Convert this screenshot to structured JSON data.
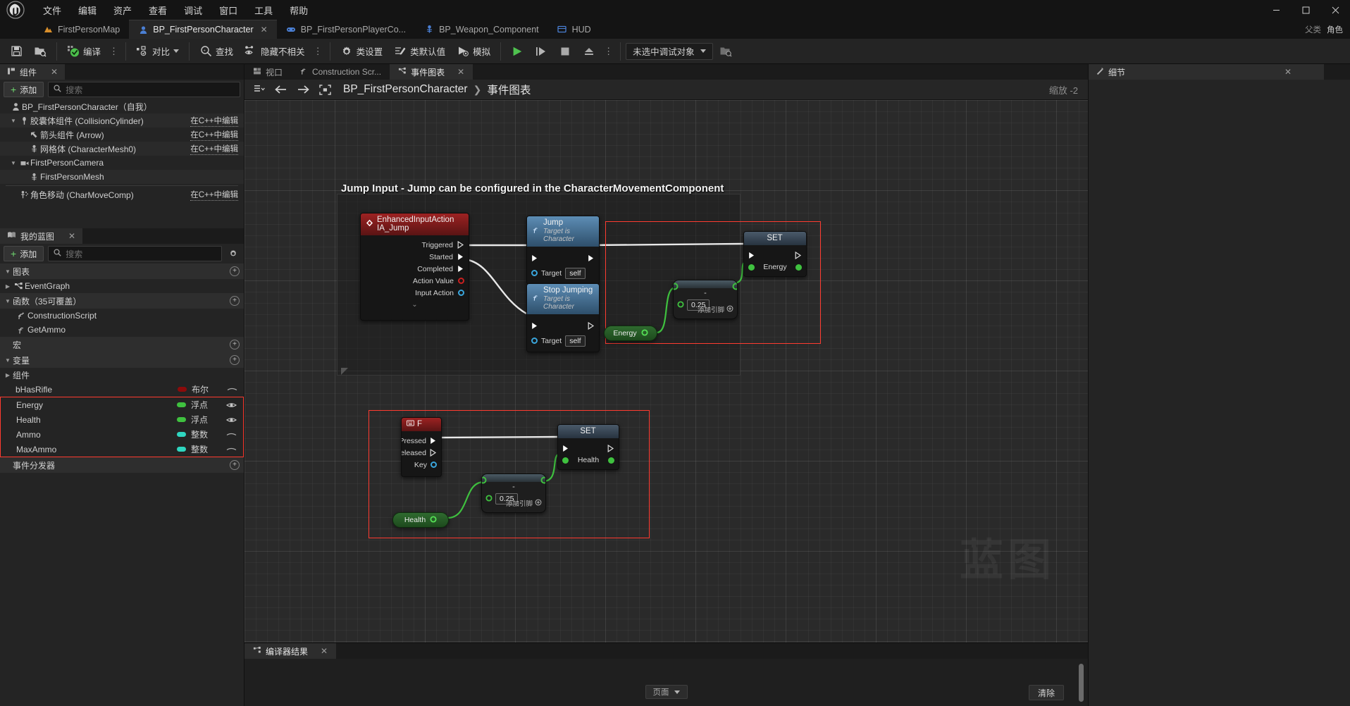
{
  "app": {
    "logo": "unreal-engine-logo",
    "menu": [
      "文件",
      "编辑",
      "资产",
      "查看",
      "调试",
      "窗口",
      "工具",
      "帮助"
    ],
    "window_controls": {
      "minimize": "–",
      "maximize": "▢",
      "close": "✕"
    }
  },
  "tabs": [
    {
      "label": "FirstPersonMap",
      "icon": "map-icon",
      "active": false,
      "closable": false
    },
    {
      "label": "BP_FirstPersonCharacter",
      "icon": "character-icon",
      "active": true,
      "closable": true
    },
    {
      "label": "BP_FirstPersonPlayerCo...",
      "icon": "gamepad-icon",
      "active": false,
      "closable": false
    },
    {
      "label": "BP_Weapon_Component",
      "icon": "skeleton-icon",
      "active": false,
      "closable": false
    },
    {
      "label": "HUD",
      "icon": "hud-icon",
      "active": false,
      "closable": false
    }
  ],
  "tab_meta": {
    "parent_label": "父类",
    "parent_value": "角色"
  },
  "toolbar": {
    "save": "保存",
    "browse": "浏览",
    "compile": "编译",
    "diff": "对比",
    "find": "查找",
    "hide_unrelated": "隐藏不相关",
    "class_settings": "类设置",
    "class_defaults": "类默认值",
    "simulate": "模拟",
    "play": "播放",
    "step": "单步",
    "stop": "停止",
    "eject": "弹出",
    "debug_object": "未选中调试对象"
  },
  "components_panel": {
    "title": "组件",
    "add_label": "添加",
    "search_placeholder": "搜索",
    "cpp_link": "在C++中编辑",
    "items": [
      {
        "label": "BP_FirstPersonCharacter（自我）",
        "icon": "character-icon",
        "depth": 0,
        "expander": "",
        "cpp": false
      },
      {
        "label": "胶囊体组件 (CollisionCylinder)",
        "icon": "capsule-icon",
        "depth": 1,
        "expander": "down",
        "cpp": true
      },
      {
        "label": "箭头组件 (Arrow)",
        "icon": "arrow-icon",
        "depth": 2,
        "expander": "",
        "cpp": true
      },
      {
        "label": "网格体 (CharacterMesh0)",
        "icon": "mesh-icon",
        "depth": 2,
        "expander": "",
        "cpp": true
      },
      {
        "label": "FirstPersonCamera",
        "icon": "camera-icon",
        "depth": 1,
        "expander": "down",
        "cpp": false
      },
      {
        "label": "FirstPersonMesh",
        "icon": "mesh-icon",
        "depth": 2,
        "expander": "",
        "cpp": false
      },
      {
        "label": "角色移动 (CharMoveComp)",
        "icon": "movement-icon",
        "depth": 1,
        "expander": "",
        "cpp": true
      }
    ]
  },
  "myblueprint_panel": {
    "title": "我的蓝图",
    "add_label": "添加",
    "search_placeholder": "搜索",
    "sections": [
      {
        "name": "图表",
        "expander": "down",
        "rows": [
          {
            "label": "EventGraph",
            "icon": "graph-icon",
            "expander": "right"
          }
        ]
      },
      {
        "name": "函数（35可覆盖）",
        "expander": "down",
        "rows": [
          {
            "label": "ConstructionScript",
            "icon": "function-construct-icon",
            "expander": ""
          },
          {
            "label": "GetAmmo",
            "icon": "function-icon",
            "expander": ""
          }
        ]
      },
      {
        "name": "宏",
        "expander": "",
        "rows": []
      },
      {
        "name": "变量",
        "expander": "down",
        "rows": []
      }
    ],
    "components_group": {
      "label": "组件",
      "expander": "right"
    },
    "variables": [
      {
        "name": "bHasRifle",
        "type": "布尔",
        "color": "#8c0b0b",
        "eye": "hidden-eye",
        "highlighted": false
      },
      {
        "name": "Energy",
        "type": "浮点",
        "color": "#3fc13f",
        "eye": "visible-eye",
        "highlighted": true
      },
      {
        "name": "Health",
        "type": "浮点",
        "color": "#3fc13f",
        "eye": "visible-eye",
        "highlighted": true
      },
      {
        "name": "Ammo",
        "type": "整数",
        "color": "#2fd6c0",
        "eye": "hidden-eye",
        "highlighted": true
      },
      {
        "name": "MaxAmmo",
        "type": "整数",
        "color": "#2fd6c0",
        "eye": "hidden-eye",
        "highlighted": true
      }
    ],
    "event_dispatchers": "事件分发器"
  },
  "graph_tabs": [
    {
      "label": "视口",
      "icon": "viewport-icon",
      "active": false,
      "closable": false
    },
    {
      "label": "Construction Scr...",
      "icon": "function-icon",
      "active": false,
      "closable": false
    },
    {
      "label": "事件图表",
      "icon": "graph-icon",
      "active": true,
      "closable": true
    }
  ],
  "graph_toolbar": {
    "breadcrumb_root": "BP_FirstPersonCharacter",
    "breadcrumb_sep": "❯",
    "breadcrumb_leaf": "事件图表",
    "zoom_label": "缩放 -2",
    "back": "←",
    "forward": "→"
  },
  "graph": {
    "comment_title": "Jump Input - Jump can be configured in the CharacterMovementComponent",
    "watermark": "蓝图",
    "nodes": {
      "input_jump": {
        "title": "EnhancedInputAction IA_Jump",
        "pins": [
          "Triggered",
          "Started",
          "Completed",
          "Action Value",
          "Input Action"
        ]
      },
      "jump": {
        "title": "Jump",
        "subtitle": "Target is Character",
        "target_label": "Target",
        "target_value": "self"
      },
      "stop_jumping": {
        "title": "Stop Jumping",
        "subtitle": "Target is Character",
        "target_label": "Target",
        "target_value": "self"
      },
      "set_energy": {
        "title": "SET",
        "var_label": "Energy"
      },
      "sub_energy": {
        "value": "0.25",
        "operator": "-",
        "add_pin_label": "添加引脚"
      },
      "get_energy": {
        "label": "Energy"
      },
      "key_f": {
        "title": "F",
        "pins": [
          "Pressed",
          "Released",
          "Key"
        ]
      },
      "set_health": {
        "title": "SET",
        "var_label": "Health"
      },
      "sub_health": {
        "value": "0.25",
        "operator": "-",
        "add_pin_label": "添加引脚"
      },
      "get_health": {
        "label": "Health"
      }
    }
  },
  "details_panel": {
    "title": "细节"
  },
  "compiler_panel": {
    "title": "编译器结果",
    "page_label": "页面",
    "clear_label": "清除"
  }
}
